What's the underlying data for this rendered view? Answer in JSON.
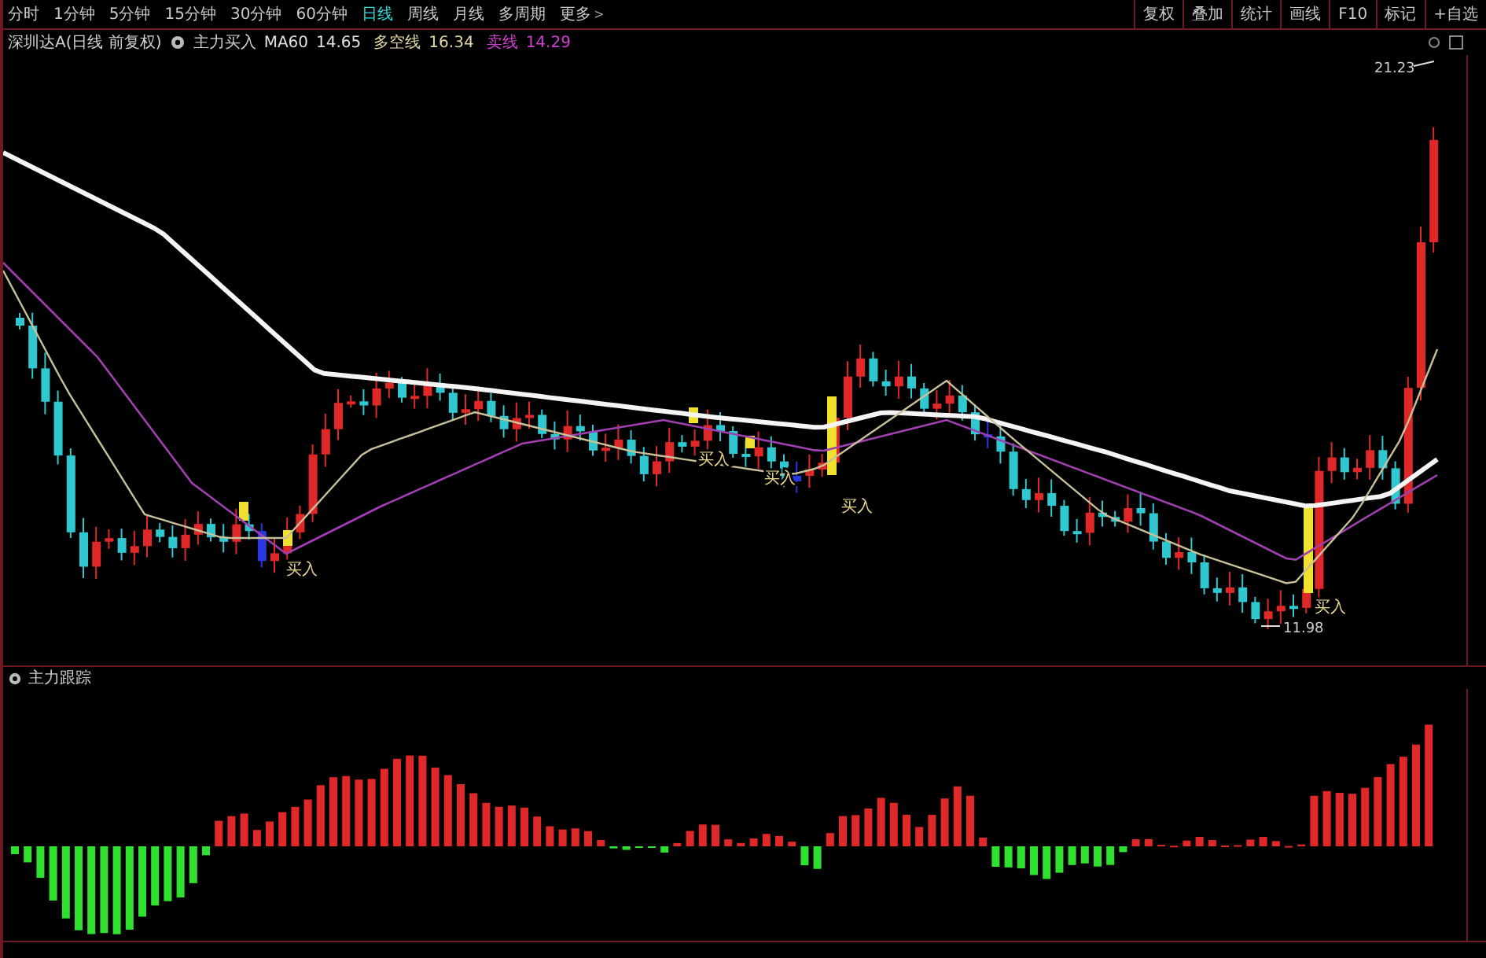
{
  "period_tabs": [
    {
      "label": "分时",
      "selected": false
    },
    {
      "label": "1分钟",
      "selected": false
    },
    {
      "label": "5分钟",
      "selected": false
    },
    {
      "label": "15分钟",
      "selected": false
    },
    {
      "label": "30分钟",
      "selected": false
    },
    {
      "label": "60分钟",
      "selected": false
    },
    {
      "label": "日线",
      "selected": true
    },
    {
      "label": "周线",
      "selected": false
    },
    {
      "label": "月线",
      "selected": false
    },
    {
      "label": "多周期",
      "selected": false
    },
    {
      "label": "更多＞",
      "selected": false
    }
  ],
  "toolbar_buttons": [
    "复权",
    "叠加",
    "统计",
    "画线",
    "F10",
    "标记",
    "+自选"
  ],
  "legend": {
    "title": "深圳达A(日线 前复权)",
    "indicator": "主力买入",
    "items": [
      {
        "label": "MA60",
        "value": "14.65",
        "color": "#e0e0e0"
      },
      {
        "label": "多空线",
        "value": "16.34",
        "color": "#e0d8a0"
      },
      {
        "label": "卖线",
        "value": "14.29",
        "color": "#d040d0"
      }
    ]
  },
  "price_chart": {
    "high_label": "21.23",
    "low_label": "11.98",
    "buy_signals": [
      {
        "label": "买入"
      },
      {
        "label": "买入"
      },
      {
        "label": "买入"
      },
      {
        "label": "买入"
      },
      {
        "label": "买入"
      }
    ]
  },
  "indicator_panel": {
    "title": "主力跟踪"
  }
}
